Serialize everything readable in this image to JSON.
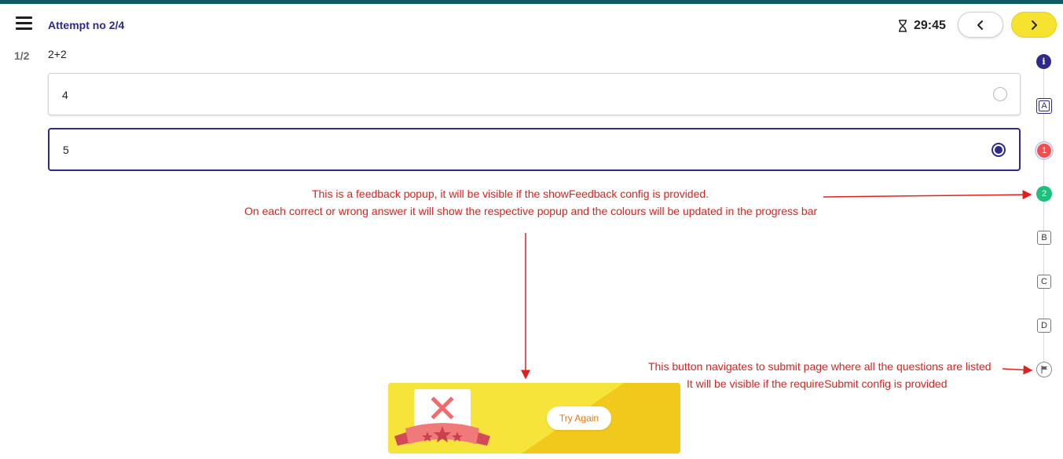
{
  "header": {
    "attempt_label": "Attempt no 2/4",
    "timer": "29:45",
    "prev_icon": "chevron-left-icon",
    "next_icon": "chevron-right-icon"
  },
  "question": {
    "number": "1/2",
    "text": "2+2",
    "options": [
      {
        "label": "4",
        "selected": false
      },
      {
        "label": "5",
        "selected": true
      }
    ]
  },
  "annotations": {
    "feedback_line1": "This is a feedback popup, it will be visible if the showFeedback config is provided.",
    "feedback_line2": "On each correct or wrong answer it will show the respective popup and the colours will be updated in the progress bar",
    "submit_line1": "This button navigates to submit page where all the questions are listed",
    "submit_line2": "It will be visible if the requireSubmit config is provided"
  },
  "progress": {
    "items": [
      {
        "label": "i",
        "state": "info"
      },
      {
        "label": "A",
        "state": "current-section"
      },
      {
        "label": "1",
        "state": "wrong"
      },
      {
        "label": "2",
        "state": "correct"
      },
      {
        "label": "B",
        "state": "section"
      },
      {
        "label": "C",
        "state": "section"
      },
      {
        "label": "D",
        "state": "section"
      },
      {
        "label": "",
        "state": "submit-flag"
      }
    ]
  },
  "feedback_popup": {
    "button_label": "Try Again",
    "state": "wrong"
  },
  "colors": {
    "primary": "#2d2a8c",
    "next_button": "#f5e330",
    "wrong": "#f25050",
    "correct": "#1fc07a",
    "annotation": "#e02020",
    "topbar": "#0f5b63"
  }
}
